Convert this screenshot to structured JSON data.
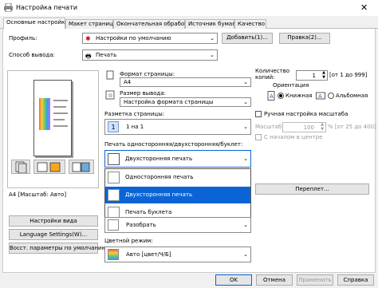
{
  "window": {
    "title": "Настройка печати",
    "close_glyph": "✕"
  },
  "tabs": [
    {
      "label": "Основные настройки"
    },
    {
      "label": "Макет страницы"
    },
    {
      "label": "Окончательная обработка"
    },
    {
      "label": "Источник бумаги"
    },
    {
      "label": "Качество"
    }
  ],
  "profile": {
    "label": "Профиль:",
    "value": "Настройки по умолчанию",
    "add_label": "Добавить(1)...",
    "edit_label": "Правка(2)..."
  },
  "output": {
    "label": "Способ вывода:",
    "value": "Печать"
  },
  "preview": {
    "caption": "A4 [Масштаб: Авто]"
  },
  "left_buttons": {
    "view_settings": "Настройки вида",
    "language_settings": "Language Settings(W)...",
    "restore_defaults": "Восст. параметры по умолчанию"
  },
  "page_size": {
    "label": "Формат страницы:",
    "value": "A4"
  },
  "output_size": {
    "label": "Размер вывода:",
    "value": "Настройка формата страницы"
  },
  "layout": {
    "label": "Разметка страницы:",
    "value": "1 на 1",
    "icon_text": "1"
  },
  "print_mode": {
    "label": "Печать односторонняя/двухсторонняя/буклет:",
    "value": "Двухсторонняя печать",
    "options": [
      "Односторонняя печать",
      "Двухсторонняя печать",
      "Печать буклета"
    ],
    "selected_index": 1
  },
  "collate": {
    "value": "Разобрать"
  },
  "copies": {
    "label": "Количество копий:",
    "value": "1",
    "range": "[от 1 до 999]"
  },
  "orientation": {
    "label": "Ориентация",
    "portrait": "Книжная",
    "landscape": "Альбомная",
    "selected": "portrait"
  },
  "manual_scaling": {
    "label": "Ручная настройка масштаба",
    "scale_label": "Масштаб:",
    "scale_value": "100",
    "scale_range": "% [от 25 до 400]",
    "center_label": "С началом в центре"
  },
  "overlay_button": "Переплет...",
  "color_mode": {
    "label": "Цветной режим:",
    "value": "Авто [цвет/Ч/Б]"
  },
  "bottom_buttons": {
    "ok": "OK",
    "cancel": "Отмена",
    "apply": "Применить",
    "help": "Справка"
  }
}
